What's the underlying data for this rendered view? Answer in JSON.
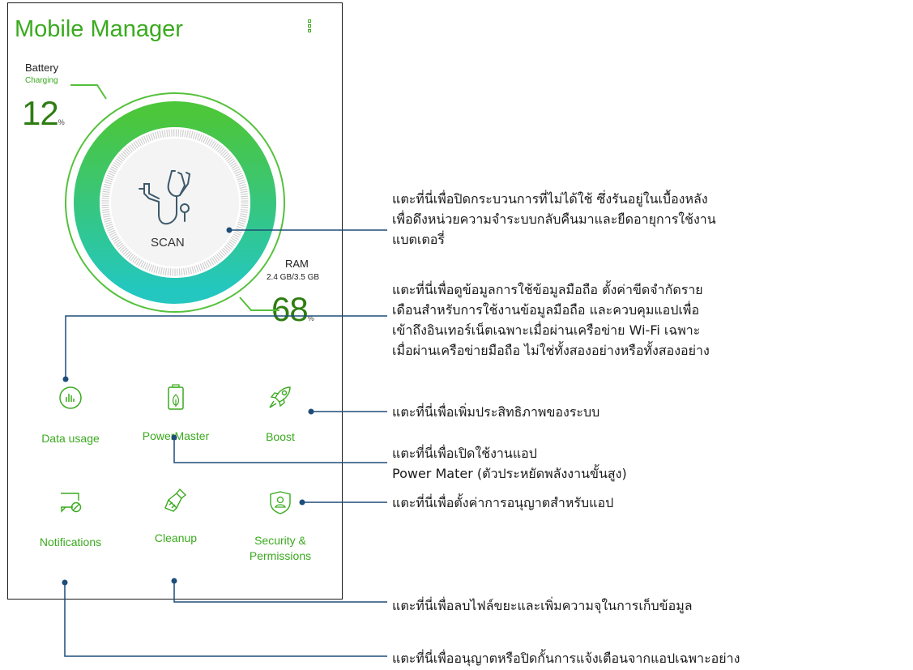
{
  "app": {
    "title": "Mobile Manager"
  },
  "battery": {
    "label": "Battery",
    "status": "Charging",
    "value": "12",
    "unit": "%"
  },
  "ram": {
    "label": "RAM",
    "usage": "2.4 GB/3.5 GB",
    "value": "68",
    "unit": "%"
  },
  "scan": {
    "label": "SCAN",
    "icon": "stethoscope-icon"
  },
  "tiles": [
    {
      "label": "Data usage",
      "icon": "data-usage-icon"
    },
    {
      "label": "PowerMaster",
      "icon": "battery-leaf-icon"
    },
    {
      "label": "Boost",
      "icon": "rocket-icon"
    },
    {
      "label": "Notifications",
      "icon": "notification-off-icon"
    },
    {
      "label": "Cleanup",
      "icon": "broom-icon"
    },
    {
      "label": "Security & Permissions",
      "icon": "shield-user-icon"
    }
  ],
  "callouts": {
    "scan": [
      "แตะที่นี่เพื่อปิดกระบวนการที่ไม่ได้ใช้ ซึ่งรันอยู่ในเบื้องหลัง",
      "เพื่อดึงหน่วยความจำระบบกลับคืนมาและยืดอายุการใช้งาน",
      "แบตเตอรี่"
    ],
    "data_usage": [
      "แตะที่นี่เพื่อดูข้อมูลการใช้ข้อมูลมือถือ ตั้งค่าขีดจำกัดราย",
      "เดือนสำหรับการใช้งานข้อมูลมือถือ และควบคุมแอปเพื่อ",
      "เข้าถึงอินเทอร์เน็ตเฉพาะเมื่อผ่านเครือข่าย Wi-Fi เฉพาะ",
      "เมื่อผ่านเครือข่ายมือถือ ไม่ใช่ทั้งสองอย่างหรือทั้งสองอย่าง"
    ],
    "boost": [
      "แตะที่นี่เพื่อเพิ่มประสิทธิภาพของระบบ"
    ],
    "powermaster": [
      "แตะที่นี่เพื่อเปิดใช้งานแอป",
      "Power Mater (ตัวประหยัดพลังงานขั้นสูง)"
    ],
    "security": [
      "แตะที่นี่เพื่อตั้งค่าการอนุญาตสำหรับแอป"
    ],
    "cleanup": [
      "แตะที่นี่เพื่อลบไฟล์ขยะและเพิ่มความจุในการเก็บข้อมูล"
    ],
    "notifications": [
      "แตะที่นี่เพื่ออนุญาตหรือปิดกั้นการแจ้งเตือนจากแอปเฉพาะอย่าง"
    ]
  },
  "colors": {
    "accent": "#3aaa1e",
    "gauge_top": "#4cc63a",
    "gauge_bottom": "#23c7c0",
    "callout_line": "#1e4d7a"
  }
}
